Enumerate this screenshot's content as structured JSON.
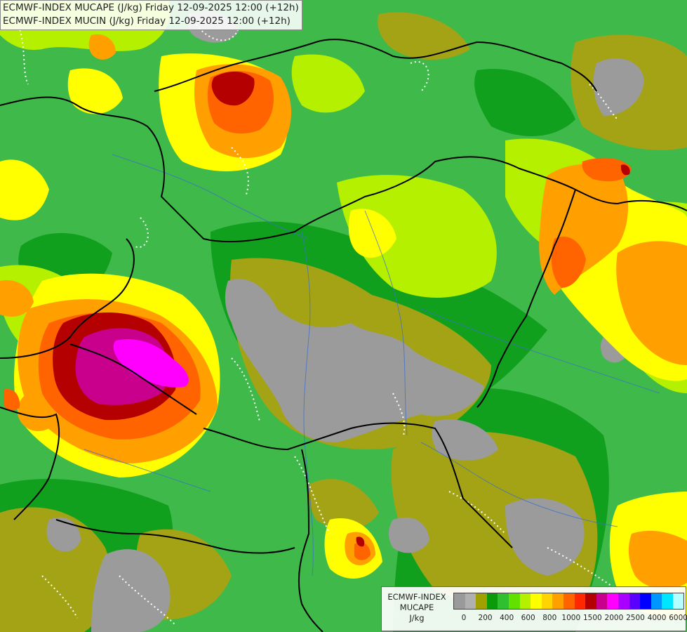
{
  "title": {
    "line1": "ECMWF-INDEX MUCAPE (J/kg) Friday 12-09-2025 12:00 (+12h)",
    "line2": "ECMWF-INDEX MUCIN (J/kg) Friday 12-09-2025 12:00 (+12h)"
  },
  "legend": {
    "model": "ECMWF-INDEX",
    "parameter": "MUCAPE",
    "unit": "J/kg",
    "colors": [
      "#9a9a9a",
      "#b0b0b0",
      "#a0a000",
      "#0a9a0a",
      "#2ec02e",
      "#62e000",
      "#b4f000",
      "#ffff00",
      "#ffd400",
      "#ffa000",
      "#ff6400",
      "#ff2800",
      "#b40000",
      "#c8008c",
      "#ff00ff",
      "#aa00ff",
      "#5a00ff",
      "#0000ff",
      "#0096ff",
      "#00e6ff",
      "#b4ffff"
    ],
    "ticks": [
      "0",
      "200",
      "400",
      "600",
      "800",
      "1000",
      "1500",
      "2000",
      "2500",
      "4000",
      "6000"
    ]
  },
  "map": {
    "palette": {
      "none": "#9b9b9b",
      "very_low": "#a3a315",
      "low": "#0f9a1c",
      "mid_low": "#34b84a",
      "mid": "#5fe01a",
      "mid_high": "#c8f000",
      "high": "#ffff00",
      "higher": "#ffc000",
      "very_high": "#ff8a00",
      "extreme": "#ff4200",
      "deep_red": "#b40000",
      "magenta_dark": "#c8008c",
      "magenta": "#ff00ff"
    }
  }
}
